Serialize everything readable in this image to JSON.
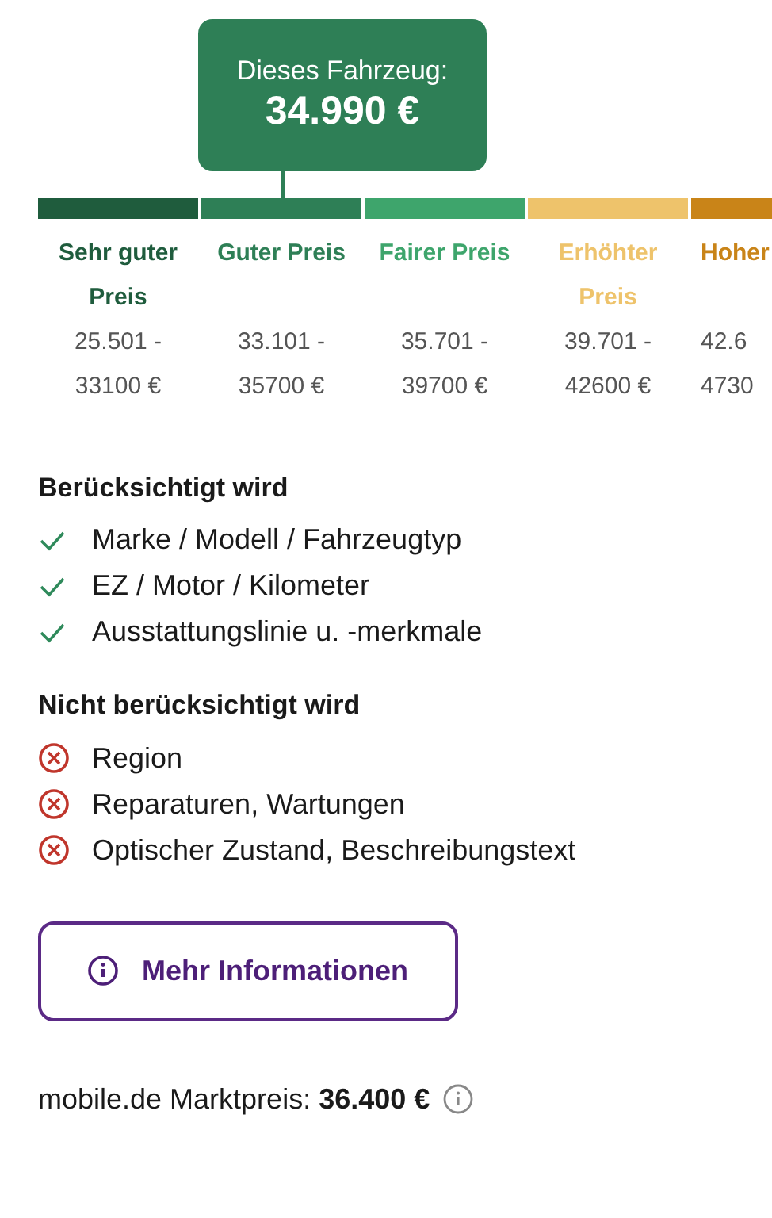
{
  "marker": {
    "label": "Dieses Fahrzeug:",
    "price": "34.990 €"
  },
  "segments": [
    {
      "label": "Sehr guter Preis",
      "range_from": "25.501 -",
      "range_to": "33100 €",
      "color": "#1f5c3d",
      "selected": false
    },
    {
      "label": "Guter Preis",
      "range_from": "33.101 -",
      "range_to": "35700 €",
      "color": "#2e7f56",
      "selected": true
    },
    {
      "label": "Fairer Preis",
      "range_from": "35.701 -",
      "range_to": "39700 €",
      "color": "#3ea56c",
      "selected": false
    },
    {
      "label": "Erhöhter Preis",
      "range_from": "39.701 -",
      "range_to": "42600 €",
      "color": "#eec36b",
      "selected": false
    },
    {
      "label": "Hoher",
      "range_from": "42.6",
      "range_to": "4730",
      "color": "#c98418",
      "selected": false
    }
  ],
  "considered": {
    "title": "Berücksichtigt wird",
    "items": [
      {
        "text": "Marke / Modell / Fahrzeugtyp",
        "kind": "check"
      },
      {
        "text": "EZ / Motor / Kilometer",
        "kind": "check"
      },
      {
        "text": "Ausstattungslinie u. -merkmale",
        "kind": "check"
      }
    ]
  },
  "not_considered": {
    "title": "Nicht berücksichtigt wird",
    "items": [
      {
        "text": "Region",
        "kind": "cross"
      },
      {
        "text": "Reparaturen, Wartungen",
        "kind": "cross"
      },
      {
        "text": "Optischer Zustand, Beschreibungstext",
        "kind": "cross"
      }
    ]
  },
  "more_button": "Mehr Informationen",
  "market_price": {
    "label": "mobile.de Marktpreis:",
    "value": "36.400 €"
  }
}
